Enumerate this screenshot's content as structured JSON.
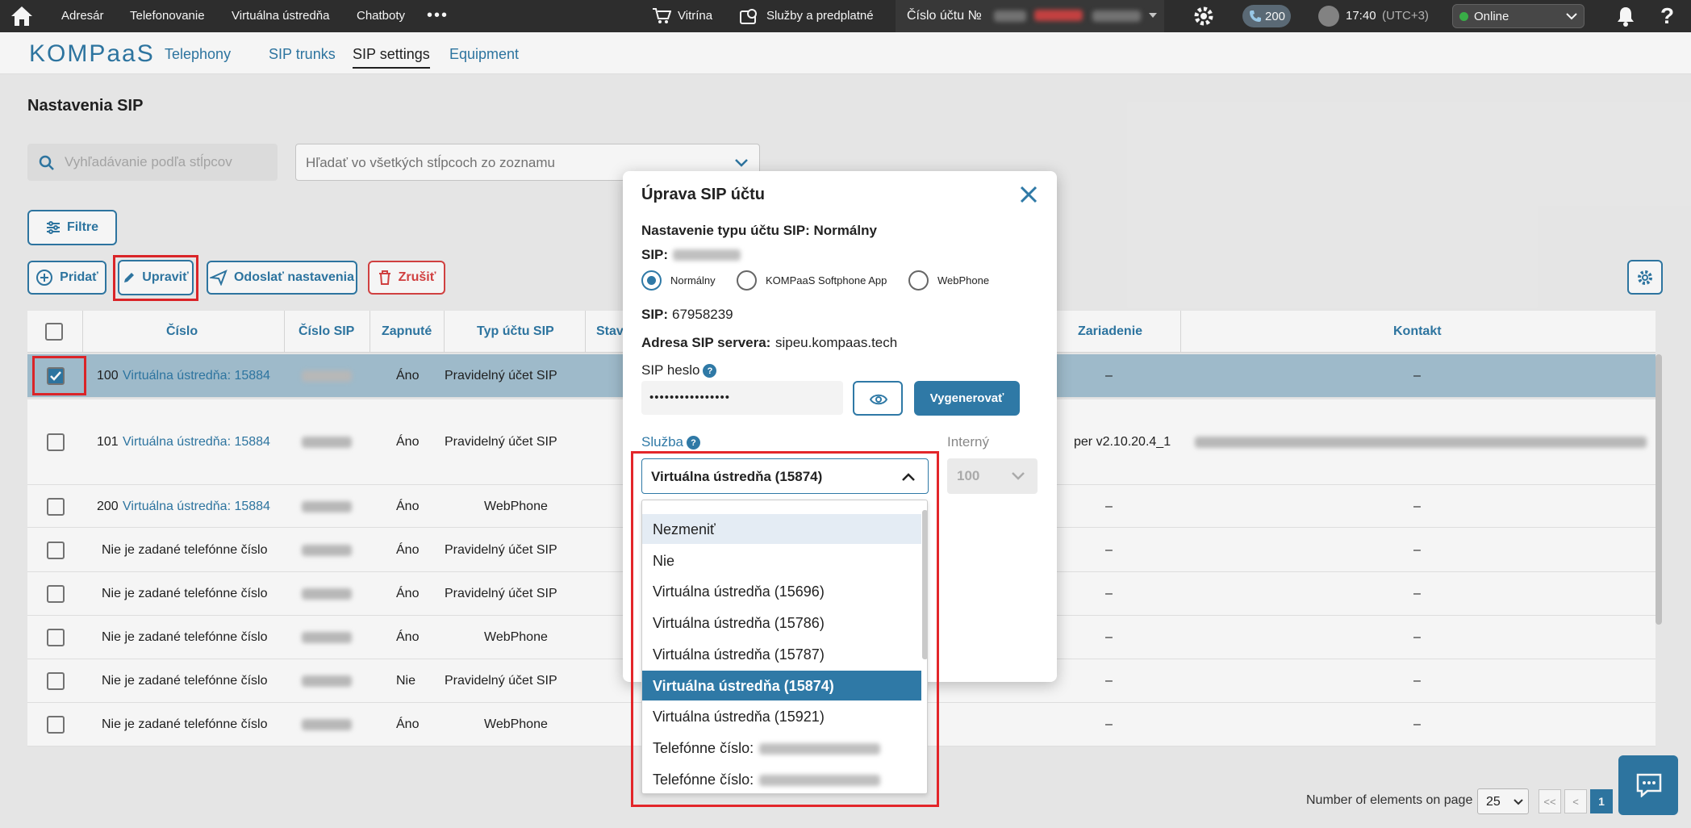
{
  "topbar": {
    "items": [
      "Adresár",
      "Telefonovanie",
      "Virtuálna ústredňa",
      "Chatboty"
    ],
    "more": "•••",
    "showcase": "Vitrína",
    "services": "Služby a predplatné",
    "account_label": "Číslo účtu №",
    "calls_badge": "200",
    "time": "17:40",
    "tz": "(UTC+3)",
    "status": "Online"
  },
  "brand": {
    "logo": "KOMPaaS"
  },
  "subnav": {
    "tabs": [
      "Telephony",
      "SIP trunks",
      "SIP settings",
      "Equipment"
    ],
    "active": "SIP settings"
  },
  "page": {
    "title": "Nastavenia SIP",
    "search_placeholder": "Vyhľadávanie podľa stĺpcov",
    "search_all": "Hľadať vo všetkých stĺpcoch zo zoznamu",
    "filter": "Filtre",
    "actions": {
      "add": "Pridať",
      "edit": "Upraviť",
      "send": "Odoslať nastavenia",
      "cancel": "Zrušiť"
    }
  },
  "table": {
    "headers": {
      "number": "Číslo",
      "sip": "Číslo SIP",
      "enabled": "Zapnuté",
      "type": "Typ účtu SIP",
      "state": "Stav",
      "device": "Zariadenie",
      "contact": "Kontakt"
    },
    "rows": [
      {
        "num": "100",
        "link": "Virtuálna ústredňa: 15884",
        "enabled": "Áno",
        "type": "Pravidelný účet SIP",
        "device": "–",
        "contact": "–",
        "selected": true
      },
      {
        "num": "101",
        "link": "Virtuálna ústredňa: 15884",
        "enabled": "Áno",
        "type": "Pravidelný účet SIP",
        "device": "per v2.10.20.4_1",
        "contact": "",
        "selected": false
      },
      {
        "num": "200",
        "link": "Virtuálna ústredňa: 15884",
        "enabled": "Áno",
        "type": "WebPhone",
        "device": "–",
        "contact": "–",
        "selected": false
      },
      {
        "num": "Nie je zadané telefónne číslo",
        "link": "",
        "enabled": "Áno",
        "type": "Pravidelný účet SIP",
        "device": "–",
        "contact": "–",
        "selected": false
      },
      {
        "num": "Nie je zadané telefónne číslo",
        "link": "",
        "enabled": "Áno",
        "type": "Pravidelný účet SIP",
        "device": "–",
        "contact": "–",
        "selected": false
      },
      {
        "num": "Nie je zadané telefónne číslo",
        "link": "",
        "enabled": "Áno",
        "type": "WebPhone",
        "device": "–",
        "contact": "–",
        "selected": false
      },
      {
        "num": "Nie je zadané telefónne číslo",
        "link": "",
        "enabled": "Nie",
        "type": "Pravidelný účet SIP",
        "device": "–",
        "contact": "–",
        "selected": false
      },
      {
        "num": "Nie je zadané telefónne číslo",
        "link": "",
        "enabled": "Áno",
        "type": "WebPhone",
        "device": "–",
        "contact": "–",
        "selected": false
      }
    ]
  },
  "pagination": {
    "label": "Number of elements on page",
    "size": "25",
    "first": "<<",
    "prev": "<",
    "page": "1"
  },
  "modal": {
    "title": "Úprava SIP účtu",
    "type_line": "Nastavenie typu účtu SIP: Normálny",
    "sip_label": "SIP:",
    "radios": [
      "Normálny",
      "KOMPaaS Softphone App",
      "WebPhone"
    ],
    "sip_number_label": "SIP:",
    "sip_number": "67958239",
    "server_label": "Adresa SIP servera:",
    "server": "sipeu.kompaas.tech",
    "password_label": "SIP heslo",
    "password": "••••••••••••••••",
    "generate": "Vygenerovať",
    "service_label": "Služba",
    "service_value": "Virtuálna ústredňa (15874)",
    "internal_label": "Interný",
    "internal_value": "100",
    "options": [
      "Nezmeniť",
      "Nie",
      "Virtuálna ústredňa (15696)",
      "Virtuálna ústredňa (15786)",
      "Virtuálna ústredňa (15787)",
      "Virtuálna ústredňa (15874)",
      "Virtuálna ústredňa (15921)",
      "Telefónne číslo:",
      "Telefónne číslo:"
    ],
    "selected_option": "Virtuálna ústredňa (15874)",
    "hovered_option": "Nezmeniť"
  },
  "colors": {
    "accent": "#2f79a6",
    "topbar": "#2f2f2f",
    "highlight": "#e3262a",
    "row_selected": "#a5c2d3"
  }
}
